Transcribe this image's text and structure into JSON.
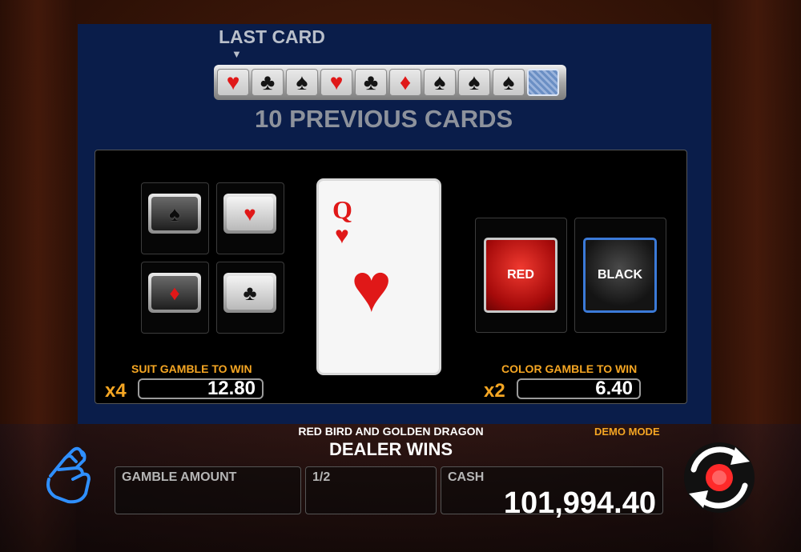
{
  "history": {
    "last_card_label": "LAST CARD",
    "caption": "10 PREVIOUS CARDS",
    "cards": [
      {
        "suit": "hearts",
        "glyph": "♥",
        "color": "red"
      },
      {
        "suit": "clubs",
        "glyph": "♣",
        "color": "black"
      },
      {
        "suit": "spades",
        "glyph": "♠",
        "color": "black"
      },
      {
        "suit": "hearts",
        "glyph": "♥",
        "color": "red"
      },
      {
        "suit": "clubs",
        "glyph": "♣",
        "color": "black"
      },
      {
        "suit": "diamonds",
        "glyph": "♦",
        "color": "red"
      },
      {
        "suit": "spades",
        "glyph": "♠",
        "color": "black"
      },
      {
        "suit": "spades",
        "glyph": "♠",
        "color": "black"
      },
      {
        "suit": "spades",
        "glyph": "♠",
        "color": "black"
      },
      {
        "suit": "card-back",
        "glyph": "",
        "color": "back"
      }
    ]
  },
  "suit_gamble": {
    "buttons": [
      {
        "suit": "spades",
        "glyph": "♠"
      },
      {
        "suit": "hearts",
        "glyph": "♥"
      },
      {
        "suit": "diamonds",
        "glyph": "♦"
      },
      {
        "suit": "clubs",
        "glyph": "♣"
      }
    ],
    "label": "SUIT GAMBLE TO WIN",
    "multiplier": "x4",
    "value": "12.80"
  },
  "current_card": {
    "rank": "Q",
    "suit_glyph": "♥",
    "suit": "hearts"
  },
  "color_gamble": {
    "red_label": "RED",
    "black_label": "BLACK",
    "label": "COLOR GAMBLE TO WIN",
    "multiplier": "x2",
    "value": "6.40"
  },
  "game_title": "RED BIRD AND GOLDEN DRAGON",
  "demo_mode": "DEMO MODE",
  "status": "DEALER WINS",
  "bottom": {
    "gamble_amount_label": "GAMBLE AMOUNT",
    "fraction_label": "1/2",
    "cash_label": "CASH",
    "cash_value": "101,994.40"
  },
  "colors": {
    "accent": "#f5a623",
    "card_red": "#e01818",
    "panel": "#0a1d4a"
  },
  "icons": {
    "collect": "hand-icon",
    "spin": "spin-refresh-icon"
  }
}
